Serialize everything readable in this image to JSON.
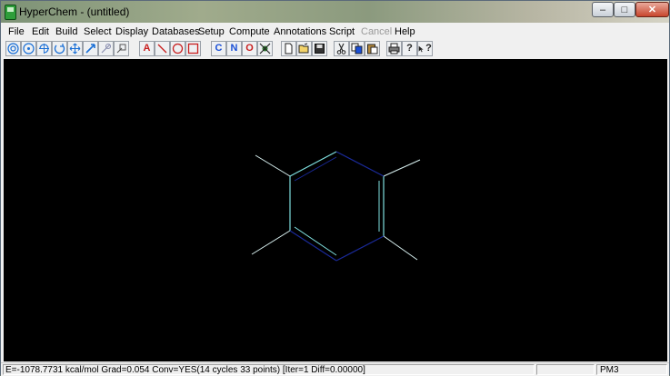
{
  "window": {
    "title": "HyperChem - (untitled)",
    "controls": {
      "minimize": "–",
      "maximize": "□",
      "close": "✕"
    }
  },
  "menu": {
    "items": [
      {
        "label": "File",
        "enabled": true
      },
      {
        "label": "Edit",
        "enabled": true
      },
      {
        "label": "Build",
        "enabled": true
      },
      {
        "label": "Select",
        "enabled": true
      },
      {
        "label": "Display",
        "enabled": true
      },
      {
        "label": "Databases",
        "enabled": true
      },
      {
        "label": "Setup",
        "enabled": true
      },
      {
        "label": "Compute",
        "enabled": true
      },
      {
        "label": "Annotations",
        "enabled": true
      },
      {
        "label": "Script",
        "enabled": true
      },
      {
        "label": "Cancel",
        "enabled": false
      },
      {
        "label": "Help",
        "enabled": true
      }
    ]
  },
  "toolbar": {
    "buttons": [
      {
        "name": "draw-tool",
        "icon": "concentric-circles-icon"
      },
      {
        "name": "select-tool",
        "icon": "target-circle-icon"
      },
      {
        "name": "rotate-xy-tool",
        "icon": "xy-rotate-icon"
      },
      {
        "name": "rotate-z-tool",
        "icon": "z-rotate-icon"
      },
      {
        "name": "translate-xy-tool",
        "icon": "cross-arrows-icon"
      },
      {
        "name": "translate-z-tool",
        "icon": "z-translate-icon"
      },
      {
        "name": "zoom-tool",
        "icon": "zoom-icon"
      },
      {
        "name": "clip-tool",
        "icon": "clip-icon"
      },
      {
        "name": "text-annotation",
        "label": "A"
      },
      {
        "name": "line-annotation",
        "icon": "line-icon"
      },
      {
        "name": "ellipse-annotation",
        "icon": "ellipse-icon"
      },
      {
        "name": "rectangle-annotation",
        "icon": "rectangle-icon"
      },
      {
        "name": "carbon-element",
        "label": "C"
      },
      {
        "name": "nitrogen-element",
        "label": "N"
      },
      {
        "name": "oxygen-element",
        "label": "O"
      },
      {
        "name": "periodic-table",
        "icon": "molecule-icon"
      },
      {
        "name": "new-file",
        "icon": "new-file-icon"
      },
      {
        "name": "open-file",
        "icon": "open-folder-icon"
      },
      {
        "name": "save-file",
        "icon": "save-icon"
      },
      {
        "name": "cut",
        "icon": "scissors-icon"
      },
      {
        "name": "copy",
        "icon": "copy-icon"
      },
      {
        "name": "paste",
        "icon": "paste-icon"
      },
      {
        "name": "print",
        "icon": "printer-icon"
      },
      {
        "name": "help",
        "label": "?"
      },
      {
        "name": "context-help",
        "label": "?"
      }
    ],
    "colors": {
      "annotation": "#c81e1e",
      "element": "#1a4fd6",
      "element_o": "#c81e1e"
    }
  },
  "molecule": {
    "ring_color_light": "#7fe0e0",
    "ring_color_dark": "#1a2a9a",
    "hydrogen_color": "#d8f0f0"
  },
  "status": {
    "message": "E=-1078.7731 kcal/mol Grad=0.054 Conv=YES(14 cycles 33 points) [Iter=1 Diff=0.00000]",
    "method": "PM3"
  }
}
